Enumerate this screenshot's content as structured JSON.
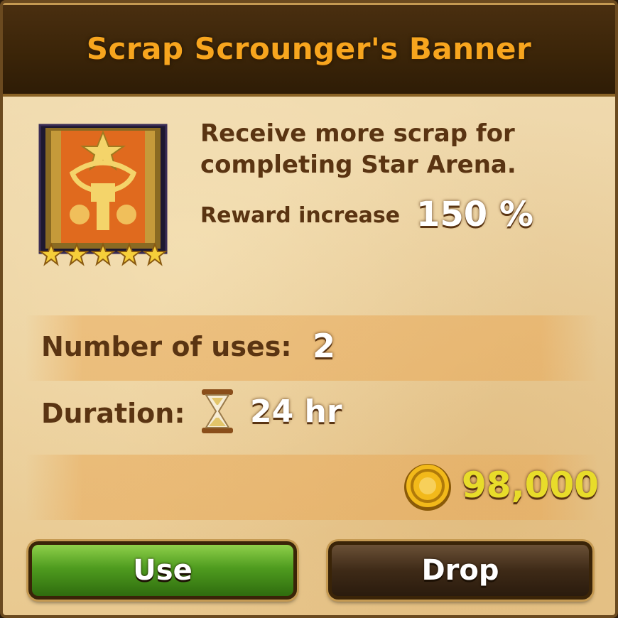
{
  "title": "Scrap Scrounger's Banner",
  "item": {
    "icon": "banner-icon",
    "stars": 5,
    "description": "Receive more scrap for completing Star Arena.",
    "reward_label": "Reward increase",
    "reward_value": "150 %"
  },
  "stats": {
    "uses_label": "Number of uses:",
    "uses_value": "2",
    "duration_label": "Duration:",
    "duration_icon": "hourglass-icon",
    "duration_value": "24 hr"
  },
  "price": {
    "icon": "gold-coin-icon",
    "value": "98,000"
  },
  "buttons": {
    "use_label": "Use",
    "drop_label": "Drop"
  },
  "colors": {
    "title": "#f7a51e",
    "price": "#e8dc2a",
    "use_button": "#4f9c1f",
    "drop_button": "#3e2a17"
  }
}
